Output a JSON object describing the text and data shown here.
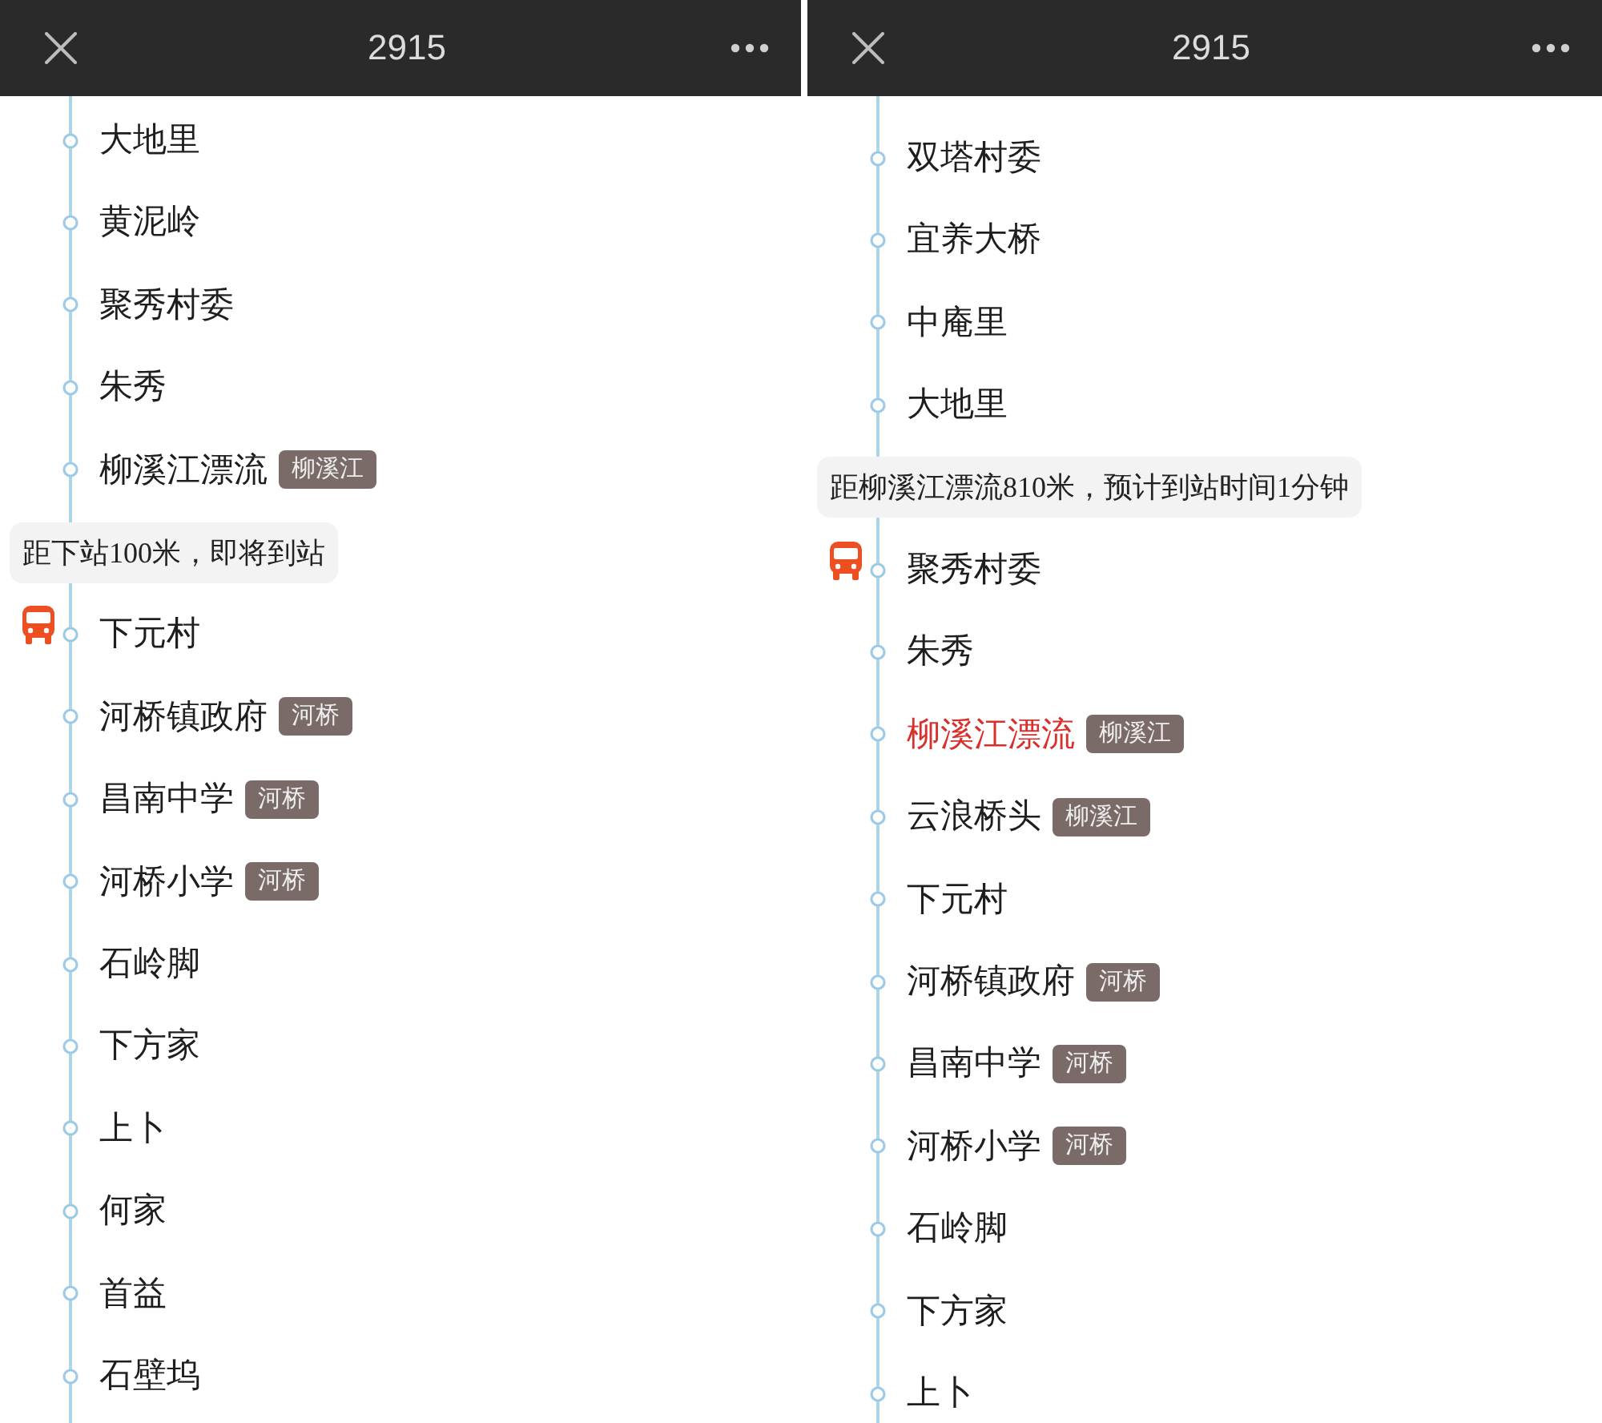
{
  "screens": [
    {
      "title": "2915",
      "stops": [
        {
          "name": "大地里",
          "selected": false,
          "bus": false
        },
        {
          "name": "黄泥岭",
          "selected": false,
          "bus": false
        },
        {
          "name": "聚秀村委",
          "selected": false,
          "bus": false
        },
        {
          "name": "朱秀",
          "selected": false,
          "bus": false
        },
        {
          "name": "柳溪江漂流",
          "tag": "柳溪江",
          "selected": false,
          "bus": false
        },
        {
          "name": "下元村",
          "selected": false,
          "bus": true,
          "notice": "距下站100米，即将到站"
        },
        {
          "name": "河桥镇政府",
          "tag": "河桥",
          "selected": false,
          "bus": false
        },
        {
          "name": "昌南中学",
          "tag": "河桥",
          "selected": false,
          "bus": false
        },
        {
          "name": "河桥小学",
          "tag": "河桥",
          "selected": false,
          "bus": false
        },
        {
          "name": "石岭脚",
          "selected": false,
          "bus": false
        },
        {
          "name": "下方家",
          "selected": false,
          "bus": false
        },
        {
          "name": "上卜",
          "selected": false,
          "bus": false
        },
        {
          "name": "何家",
          "selected": false,
          "bus": false
        },
        {
          "name": "首益",
          "selected": false,
          "bus": false
        },
        {
          "name": "石壁坞",
          "selected": false,
          "bus": false
        }
      ]
    },
    {
      "title": "2915",
      "stops": [
        {
          "name": "双塔村委",
          "selected": false,
          "bus": false
        },
        {
          "name": "宜养大桥",
          "selected": false,
          "bus": false
        },
        {
          "name": "中庵里",
          "selected": false,
          "bus": false
        },
        {
          "name": "大地里",
          "selected": false,
          "bus": false
        },
        {
          "name": "聚秀村委",
          "selected": false,
          "bus": true,
          "notice": "距柳溪江漂流810米，预计到站时间1分钟"
        },
        {
          "name": "朱秀",
          "selected": false,
          "bus": false
        },
        {
          "name": "柳溪江漂流",
          "tag": "柳溪江",
          "selected": true,
          "bus": false
        },
        {
          "name": "云浪桥头",
          "tag": "柳溪江",
          "selected": false,
          "bus": false
        },
        {
          "name": "下元村",
          "selected": false,
          "bus": false
        },
        {
          "name": "河桥镇政府",
          "tag": "河桥",
          "selected": false,
          "bus": false
        },
        {
          "name": "昌南中学",
          "tag": "河桥",
          "selected": false,
          "bus": false
        },
        {
          "name": "河桥小学",
          "tag": "河桥",
          "selected": false,
          "bus": false
        },
        {
          "name": "石岭脚",
          "selected": false,
          "bus": false
        },
        {
          "name": "下方家",
          "selected": false,
          "bus": false
        },
        {
          "name": "上卜",
          "selected": false,
          "bus": false
        }
      ]
    }
  ]
}
